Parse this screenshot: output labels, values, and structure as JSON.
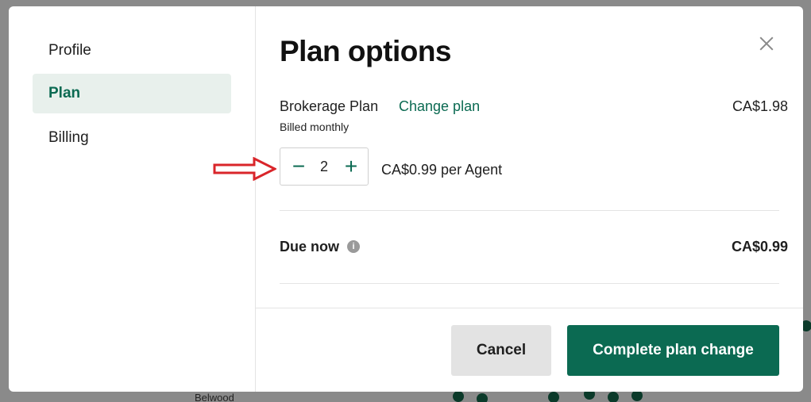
{
  "background": {
    "map_label": "Belwood"
  },
  "sidebar": {
    "items": [
      {
        "label": "Profile",
        "active": false
      },
      {
        "label": "Plan",
        "active": true
      },
      {
        "label": "Billing",
        "active": false
      }
    ]
  },
  "modal": {
    "title": "Plan options",
    "close_icon": "close-icon"
  },
  "plan": {
    "name": "Brokerage Plan",
    "change_link": "Change plan",
    "price": "CA$1.98",
    "billing_note": "Billed monthly"
  },
  "stepper": {
    "minus_icon": "minus-icon",
    "plus_icon": "plus-icon",
    "value": "2",
    "unit_price": "CA$0.99 per Agent"
  },
  "due": {
    "label": "Due now",
    "info_icon": "info-icon",
    "amount": "CA$0.99"
  },
  "footer": {
    "cancel_label": "Cancel",
    "complete_label": "Complete plan change"
  },
  "colors": {
    "accent": "#0b6a52",
    "active_bg": "#e8f0ec",
    "annotation": "#d9252a"
  }
}
